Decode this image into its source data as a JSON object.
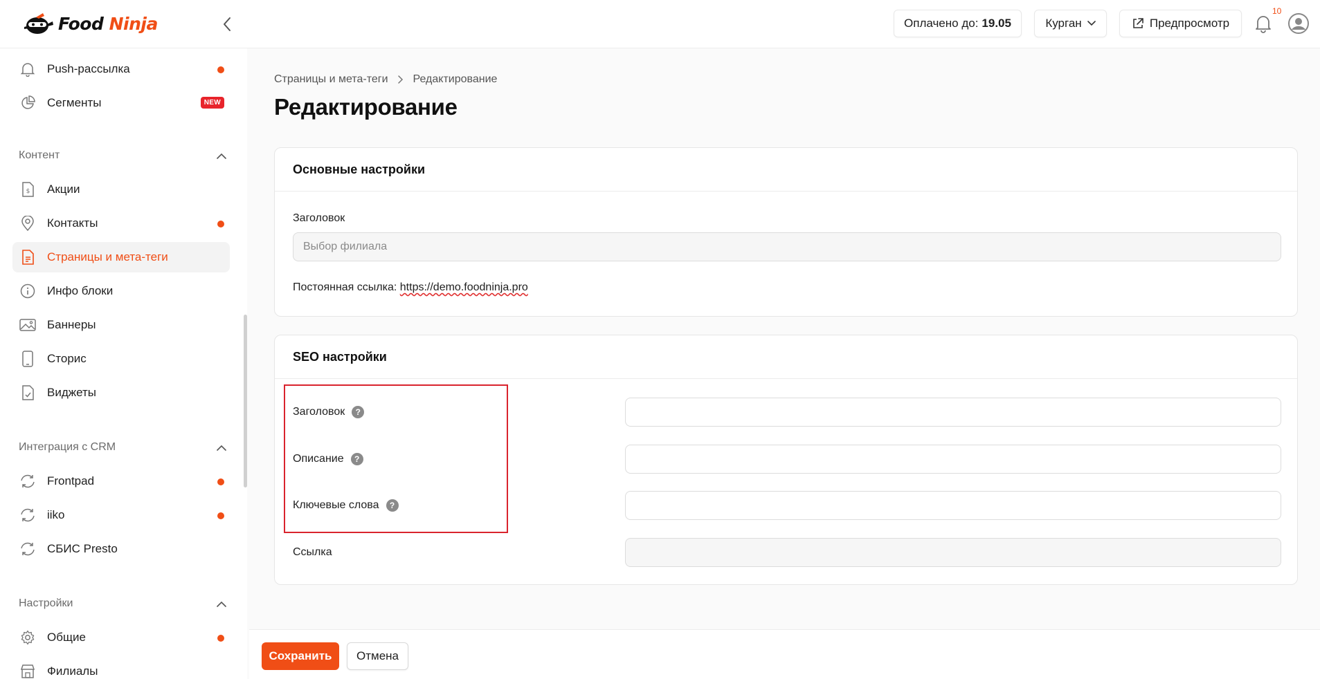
{
  "header": {
    "logo_food": "Food",
    "logo_ninja": "Ninja",
    "paid_label": "Оплачено до:",
    "paid_date": "19.05",
    "city": "Курган",
    "preview_label": "Предпросмотр",
    "notifications_count": "10"
  },
  "sidebar": {
    "items_top": [
      {
        "label": "Push-рассылка",
        "icon": "bell-icon",
        "dot": true
      },
      {
        "label": "Сегменты",
        "icon": "pie-chart-icon",
        "badge": "NEW"
      }
    ],
    "sections": [
      {
        "title": "Контент",
        "items": [
          {
            "label": "Акции",
            "icon": "dollar-document-icon",
            "dot": false
          },
          {
            "label": "Контакты",
            "icon": "map-pin-icon",
            "dot": true
          },
          {
            "label": "Страницы и мета-теги",
            "icon": "document-icon",
            "active": true
          },
          {
            "label": "Инфо блоки",
            "icon": "info-icon"
          },
          {
            "label": "Баннеры",
            "icon": "image-icon"
          },
          {
            "label": "Сторис",
            "icon": "phone-icon"
          },
          {
            "label": "Виджеты",
            "icon": "document-check-icon"
          }
        ]
      },
      {
        "title": "Интеграция с CRM",
        "items": [
          {
            "label": "Frontpad",
            "icon": "sync-icon",
            "dot": true
          },
          {
            "label": "iiko",
            "icon": "sync-icon",
            "dot": true
          },
          {
            "label": "СБИС Presto",
            "icon": "sync-icon"
          }
        ]
      },
      {
        "title": "Настройки",
        "items": [
          {
            "label": "Общие",
            "icon": "gear-icon",
            "dot": true
          },
          {
            "label": "Филиалы",
            "icon": "store-icon"
          }
        ]
      }
    ]
  },
  "breadcrumb": {
    "parent": "Страницы и мета-теги",
    "current": "Редактирование"
  },
  "page_title": "Редактирование",
  "basic_settings": {
    "title": "Основные настройки",
    "heading_label": "Заголовок",
    "heading_placeholder": "Выбор филиала",
    "permalink_label": "Постоянная ссылка:",
    "permalink_url": "https://demo.foodninja.pro"
  },
  "seo_settings": {
    "title": "SEO настройки",
    "title_label": "Заголовок",
    "description_label": "Описание",
    "keywords_label": "Ключевые слова",
    "link_label": "Ссылка",
    "help_glyph": "?"
  },
  "footer": {
    "save_label": "Сохранить",
    "cancel_label": "Отмена"
  },
  "colors": {
    "accent": "#f04e16",
    "highlight_border": "#d9232d"
  }
}
